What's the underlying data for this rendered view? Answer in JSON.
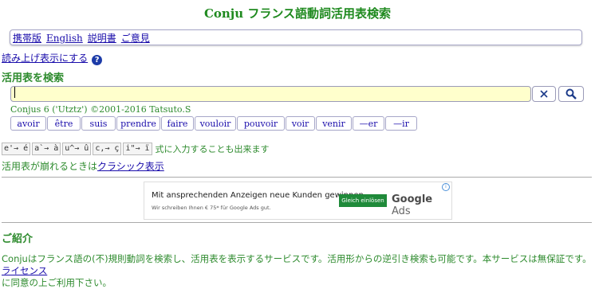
{
  "header": {
    "title": "Conju フランス語動詞活用表検索"
  },
  "nav": {
    "items": [
      "携帯版",
      "English",
      "説明書",
      "ご意見"
    ]
  },
  "tts": {
    "label": "読み上げ表示にする",
    "help_glyph": "?"
  },
  "search": {
    "heading": "活用表を検索",
    "value": "",
    "clear_label": "×",
    "copyright": "Conjus 6 ('Utztz') ©2001-2016 Tatsuto.S"
  },
  "verbs": [
    "avoir",
    "être",
    "suis",
    "prendre",
    "faire",
    "vouloir",
    "pouvoir",
    "voir",
    "venir",
    "—er",
    "—ir"
  ],
  "accents": {
    "keys": [
      "e'→ é",
      "a`→ à",
      "u^→ û",
      "c,→ ç",
      "i\"→ ï"
    ],
    "note": "式に入力することも出来ます"
  },
  "classic": {
    "prefix": "活用表が崩れるときは",
    "link": "クラシック表示"
  },
  "ad": {
    "headline": "Mit ansprechenden Anzeigen neue Kunden gewinnen.",
    "subline": "Wir schreiben Ihnen € 75* für Google Ads gut.",
    "button": "Gleich einlösen",
    "brand_google": "Google",
    "brand_ads": "Ads",
    "info": "i"
  },
  "intro": {
    "heading": "ご紹介",
    "text": "Conjuはフランス語の(不)規則動詞を検索し、活用表を表示するサービスです。活用形からの逆引き検索も可能です。本サービスは無保証です。",
    "link": "ライセンス",
    "suffix": "に同意の上ご利用下さい。"
  }
}
